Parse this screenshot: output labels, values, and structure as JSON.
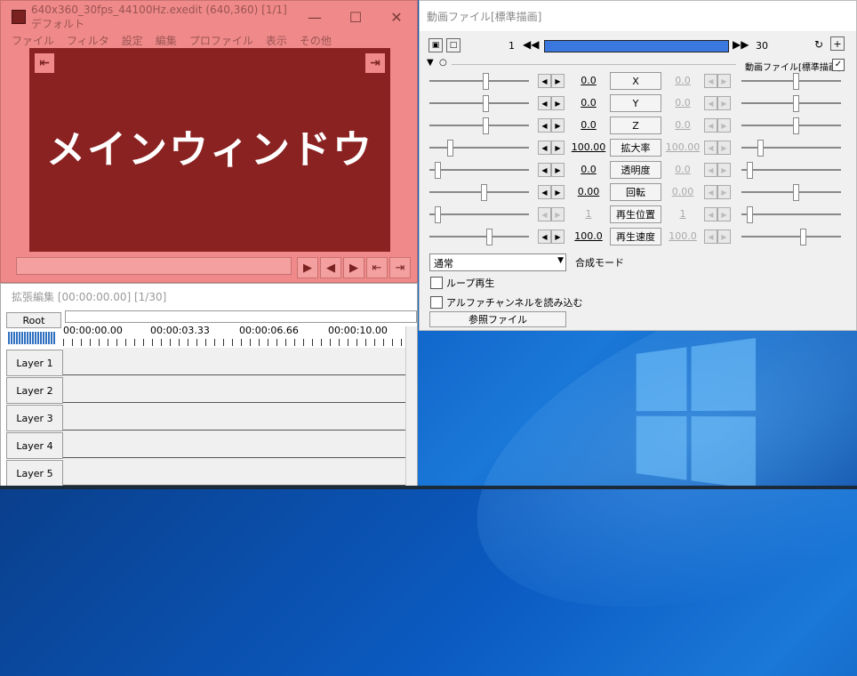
{
  "main_window": {
    "title": "640x360_30fps_44100Hz.exedit (640,360)  [1/1]  デフォルト",
    "menu": [
      "ファイル",
      "フィルタ",
      "設定",
      "編集",
      "プロファイル",
      "表示",
      "その他"
    ],
    "preview_text": "メインウィンドウ"
  },
  "ext_edit": {
    "title": "拡張編集 [00:00:00.00] [1/30]",
    "root_label": "Root",
    "times": [
      "00:00:00.00",
      "00:00:03.33",
      "00:00:06.66",
      "00:00:10.00"
    ],
    "layers": [
      "Layer 1",
      "Layer 2",
      "Layer 3",
      "Layer 4",
      "Layer 5"
    ]
  },
  "settings": {
    "title": "動画ファイル[標準描画]",
    "frame_start": "1",
    "frame_end": "30",
    "object_name": "動画ファイル[標準描画]",
    "params": [
      {
        "label": "X",
        "left": "0.0",
        "right": "0.0",
        "right_dim": true
      },
      {
        "label": "Y",
        "left": "0.0",
        "right": "0.0",
        "right_dim": true
      },
      {
        "label": "Z",
        "left": "0.0",
        "right": "0.0",
        "right_dim": true
      },
      {
        "label": "拡大率",
        "left": "100.00",
        "right": "100.00",
        "right_dim": true
      },
      {
        "label": "透明度",
        "left": "0.0",
        "right": "0.0",
        "right_dim": true
      },
      {
        "label": "回転",
        "left": "0.00",
        "right": "0.00",
        "right_dim": true
      },
      {
        "label": "再生位置",
        "left": "1",
        "right": "1",
        "right_dim": true,
        "left_dim": true
      },
      {
        "label": "再生速度",
        "left": "100.0",
        "right": "100.0",
        "right_dim": true
      }
    ],
    "blend_value": "通常",
    "blend_label": "合成モード",
    "loop_label": "ループ再生",
    "alpha_label": "アルファチャンネルを読み込む",
    "ref_button": "参照ファイル"
  }
}
